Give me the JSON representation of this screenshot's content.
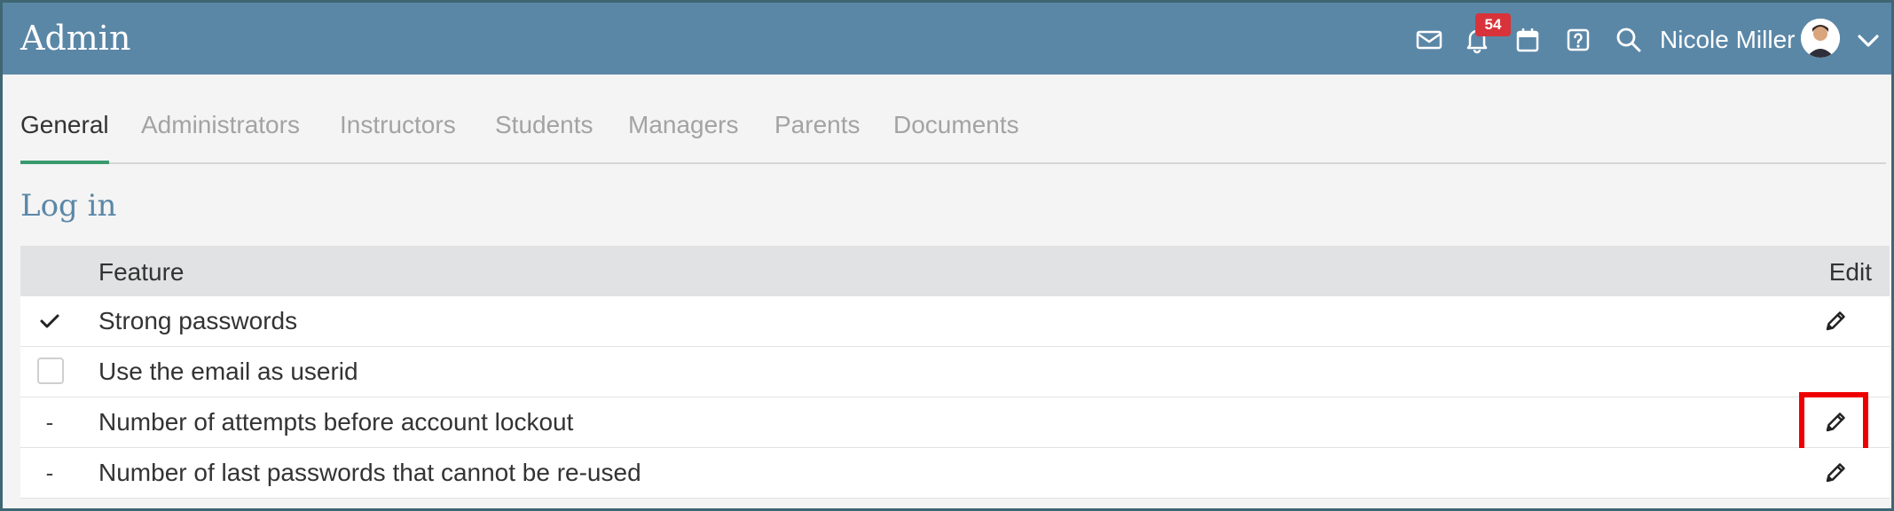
{
  "header": {
    "title": "Admin",
    "notification_count": "54",
    "user_name": "Nicole Miller",
    "icons": [
      "mail-icon",
      "bell-icon",
      "calendar-icon",
      "help-icon",
      "search-icon",
      "chevron-down-icon"
    ]
  },
  "tabs": [
    {
      "label": "General",
      "active": true
    },
    {
      "label": "Administrators"
    },
    {
      "label": "Instructors"
    },
    {
      "label": "Students"
    },
    {
      "label": "Managers"
    },
    {
      "label": "Parents"
    },
    {
      "label": "Documents"
    }
  ],
  "section": {
    "title": "Log in",
    "columns": {
      "feature": "Feature",
      "edit": "Edit"
    },
    "rows": [
      {
        "status": "checked",
        "label": "Strong passwords",
        "editable": true
      },
      {
        "status": "unchecked",
        "label": "Use the email as userid",
        "editable": false
      },
      {
        "status": "-",
        "label": "Number of attempts before account lockout",
        "editable": true,
        "highlighted": true
      },
      {
        "status": "-",
        "label": "Number of last passwords that cannot be re-used",
        "editable": true
      }
    ]
  },
  "colors": {
    "header_bg": "#5b87a7",
    "active_tab_underline": "#3a9a6f",
    "badge": "#d8333a",
    "highlight_box": "#ee0000"
  }
}
